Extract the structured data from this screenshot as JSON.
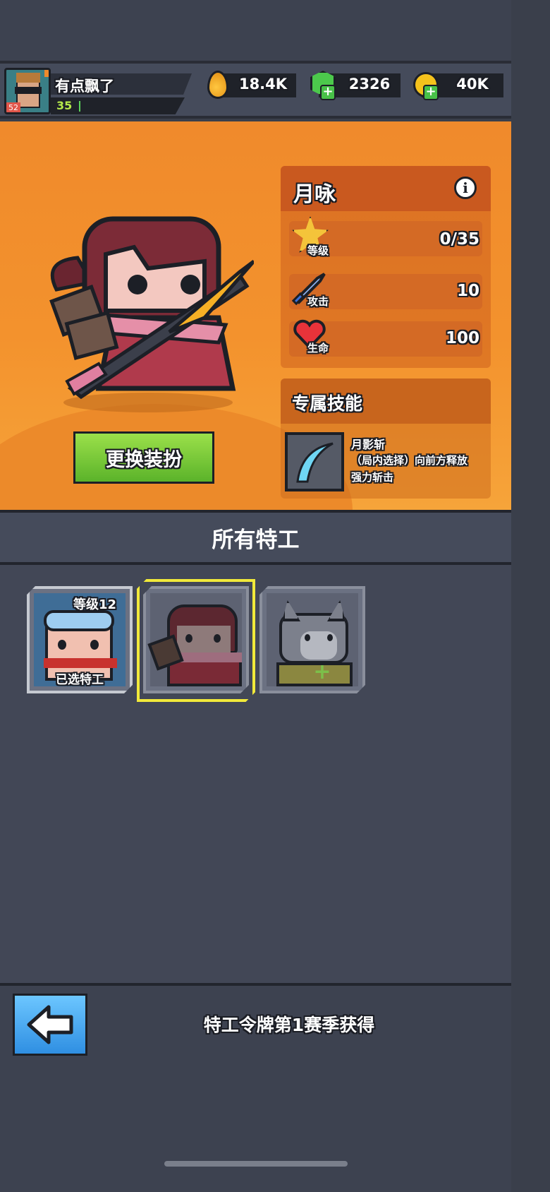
{
  "player": {
    "name": "有点飘了",
    "level": "35",
    "avatar_badge": "52"
  },
  "resources": [
    {
      "icon": "fuel-drop-icon",
      "value": "18.4K",
      "color": "#f2a024"
    },
    {
      "icon": "green-gem-icon",
      "value": "2326",
      "color": "#49c94a"
    },
    {
      "icon": "gold-coin-icon",
      "value": "40K",
      "color": "#f5c21c"
    }
  ],
  "character": {
    "name": "月咏",
    "stats": [
      {
        "icon": "star-level-icon",
        "label": "等级",
        "value": "0/35"
      },
      {
        "icon": "sword-icon",
        "label": "攻击",
        "value": "10"
      },
      {
        "icon": "heart-icon",
        "label": "生命",
        "value": "100"
      }
    ],
    "skill_section_title": "专属技能",
    "skill": {
      "name": "月影斩",
      "line1": "（局内选择）向前方释放",
      "line2": "强力斩击"
    },
    "outfit_button": "更换装扮"
  },
  "agents": {
    "title": "所有特工",
    "cards": [
      {
        "name": "goggles-agent",
        "level_label": "等级12",
        "status_label": "已选特工",
        "selected": false
      },
      {
        "name": "ninja-girl-agent",
        "level_label": "",
        "status_label": "",
        "selected": true
      },
      {
        "name": "cat-agent",
        "level_label": "",
        "status_label": "",
        "selected": false
      }
    ]
  },
  "footer": {
    "unlock_text": "特工令牌第1赛季获得"
  },
  "colors": {
    "accent_orange": "#f08a2c",
    "selected_border": "#f1e93a",
    "button_green": "#6cc22e",
    "button_blue": "#3a9ae8"
  }
}
